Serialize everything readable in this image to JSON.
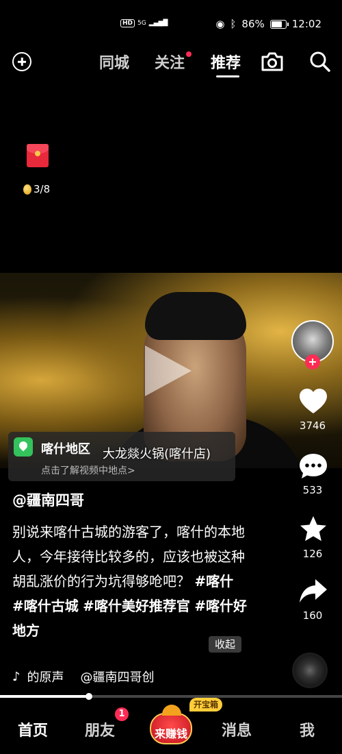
{
  "status_bar": {
    "network_hd": "HD",
    "network_gen": "5G",
    "battery_percent": "86%",
    "battery_level": 0.86,
    "time": "12:02"
  },
  "top_nav": {
    "tabs": [
      {
        "label": "同城"
      },
      {
        "label": "关注"
      },
      {
        "label": "推荐"
      }
    ],
    "active_tab": "推荐"
  },
  "reward": {
    "progress_text": "3/8"
  },
  "video": {
    "location_name": "喀什地区",
    "location_hint": "点击了解视频中地点>",
    "subtitle": "大龙燚火锅(喀什店)"
  },
  "rail": {
    "likes": "3746",
    "comments": "533",
    "favorites": "126",
    "shares": "160"
  },
  "post": {
    "author": "@疆南四哥",
    "caption_text": "别说来喀什古城的游客了，喀什的本地人，今年接待比较多的，应该也被这种胡乱涨价的行为坑得够呛吧？",
    "hashtags": [
      "#喀什",
      "#喀什古城",
      "#喀什美好推荐官",
      "#喀什好地方"
    ],
    "collapse_label": "收起",
    "music_label": "的原声",
    "music_author": "@疆南四哥创"
  },
  "playback": {
    "progress_fraction": 0.26
  },
  "bottom_nav": {
    "home": "首页",
    "friends": "朋友",
    "friends_badge": "1",
    "earn": "来赚钱",
    "chest_tag": "开宝箱",
    "messages": "消息",
    "me": "我"
  },
  "colors": {
    "accent_red": "#fe2c55",
    "location_green": "#34c25c"
  }
}
